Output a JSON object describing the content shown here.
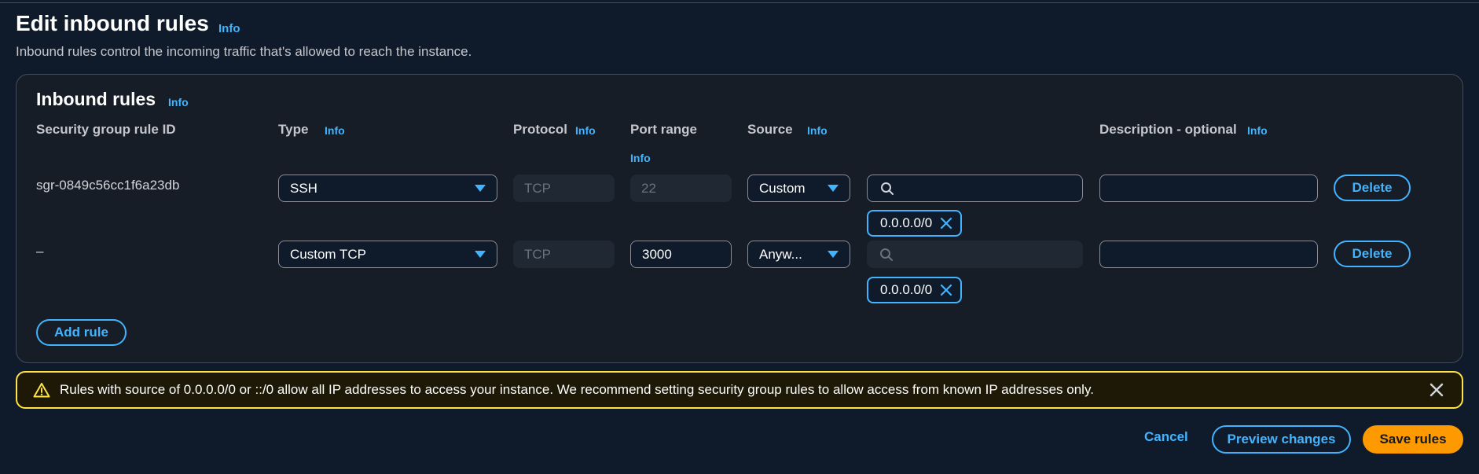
{
  "page": {
    "title": "Edit inbound rules",
    "info": "Info",
    "description": "Inbound rules control the incoming traffic that's allowed to reach the instance."
  },
  "panel": {
    "title": "Inbound rules",
    "info": "Info",
    "columns": {
      "rule_id": "Security group rule ID",
      "type": "Type",
      "protocol": "Protocol",
      "port_range": "Port range",
      "source": "Source",
      "description": "Description - optional"
    },
    "rows": [
      {
        "rule_id": "sgr-0849c56cc1f6a23db",
        "type": "SSH",
        "protocol": "TCP",
        "port": "22",
        "source": "Custom",
        "source_search": "",
        "cidr": "0.0.0.0/0",
        "description": "",
        "delete_label": "Delete"
      },
      {
        "rule_id": "–",
        "type": "Custom TCP",
        "protocol": "TCP",
        "port": "3000",
        "source": "Anyw...",
        "source_search": "",
        "cidr": "0.0.0.0/0",
        "description": "",
        "delete_label": "Delete"
      }
    ],
    "add_rule_label": "Add rule"
  },
  "alert": {
    "text": "Rules with source of 0.0.0.0/0 or ::/0 allow all IP addresses to access your instance. We recommend setting security group rules to allow access from known IP addresses only."
  },
  "footer": {
    "cancel_label": "Cancel",
    "preview_label": "Preview changes",
    "save_label": "Save rules"
  },
  "colors": {
    "background": "#0f1b2a",
    "accent": "#42b4ff",
    "warning": "#ffe347",
    "primary_button": "#ff9900"
  },
  "icons": [
    "search-icon",
    "caret-down-icon",
    "close-icon",
    "warning-icon"
  ]
}
